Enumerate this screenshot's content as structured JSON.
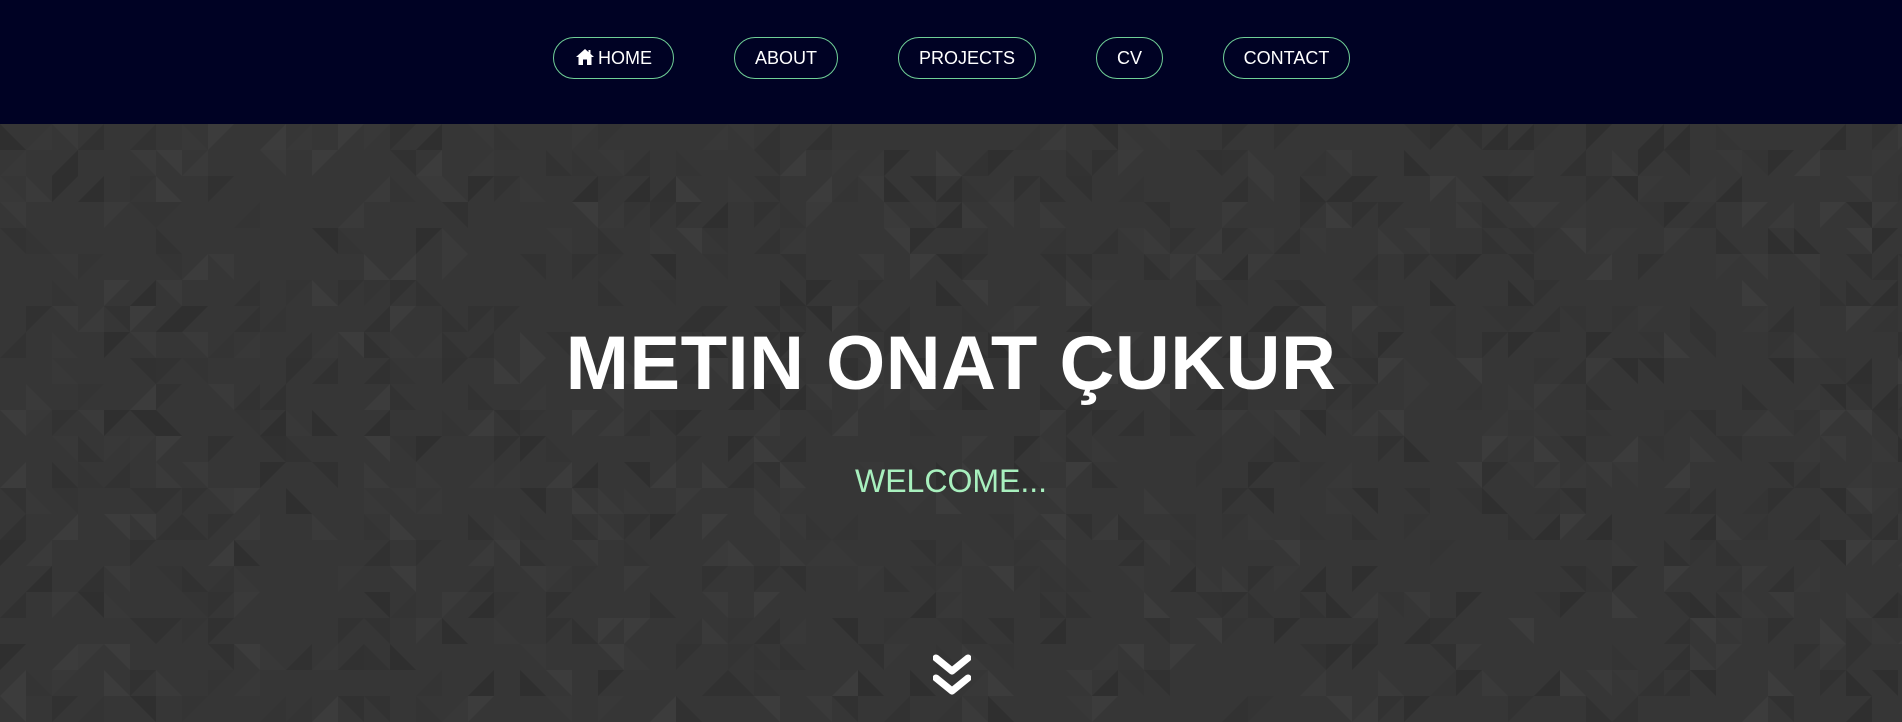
{
  "nav": {
    "items": [
      {
        "label": "HOME",
        "icon": "home-icon"
      },
      {
        "label": "ABOUT"
      },
      {
        "label": "PROJECTS"
      },
      {
        "label": "CV"
      },
      {
        "label": "CONTACT"
      }
    ]
  },
  "hero": {
    "title": "METIN ONAT ÇUKUR",
    "subtitle": "WELCOME...",
    "scroll_icon": "double-chevron-down-icon"
  },
  "colors": {
    "navbar_bg": "#000224",
    "nav_border": "#6fcf97",
    "hero_bg": "#363636",
    "subtitle": "#a8f0be",
    "text": "#ffffff"
  }
}
